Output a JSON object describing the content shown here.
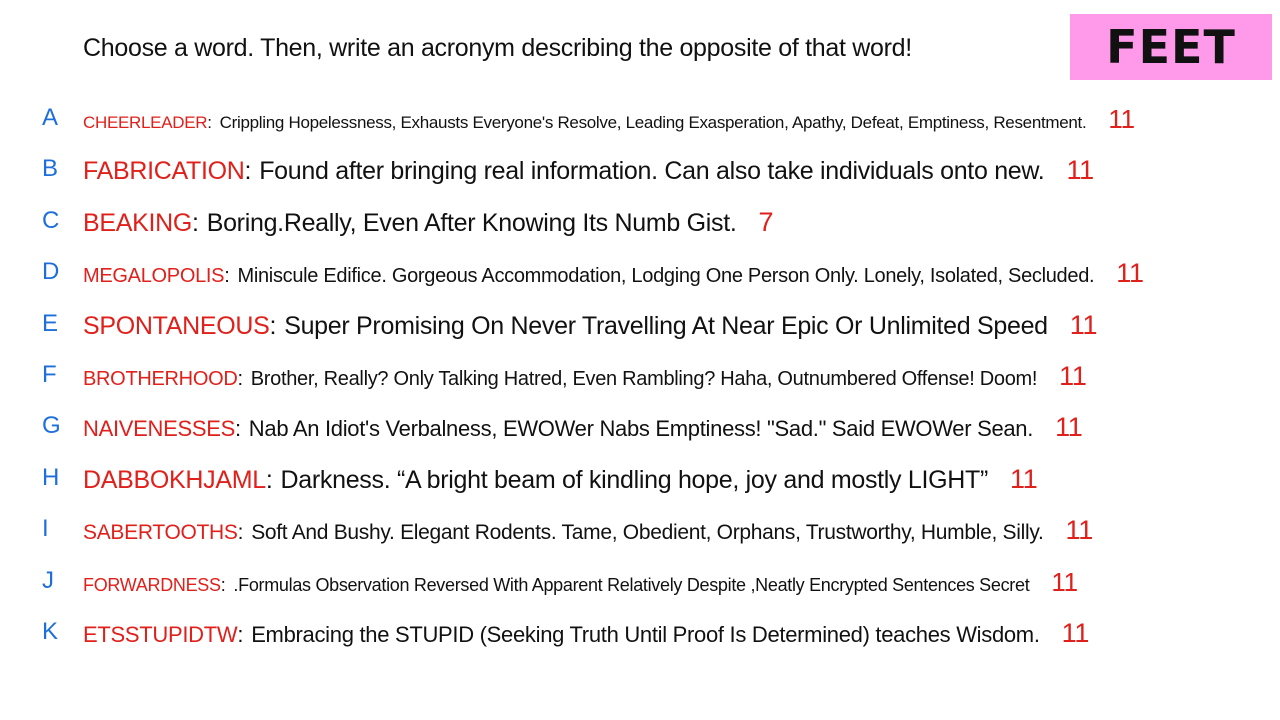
{
  "prompt": "Choose a word. Then, write an acronym describing the opposite of that word!",
  "badge": "FEET",
  "entries": [
    {
      "letter": "A",
      "word": "CHEERLEADER",
      "acronym": "Crippling Hopelessness, Exhausts Everyone's Resolve, Leading Exasperation, Apathy, Defeat, Emptiness, Resentment.",
      "score": "11"
    },
    {
      "letter": "B",
      "word": "FABRICATION",
      "acronym": "Found after bringing real information. Can also take individuals onto new.",
      "score": "11"
    },
    {
      "letter": "C",
      "word": "BEAKING",
      "acronym": "Boring.Really, Even After Knowing Its Numb Gist.",
      "score": "7"
    },
    {
      "letter": "D",
      "word": "MEGALOPOLIS",
      "acronym": "Miniscule Edifice. Gorgeous Accommodation, Lodging One Person Only. Lonely, Isolated, Secluded.",
      "score": "11"
    },
    {
      "letter": "E",
      "word": "SPONTANEOUS",
      "acronym": "Super Promising On Never Travelling At Near Epic Or Unlimited Speed",
      "score": "11"
    },
    {
      "letter": "F",
      "word": "BROTHERHOOD",
      "acronym": "Brother, Really? Only Talking Hatred, Even Rambling? Haha, Outnumbered Offense! Doom!",
      "score": "11"
    },
    {
      "letter": "G",
      "word": "NAIVENESSES",
      "acronym": "Nab An Idiot's Verbalness, EWOWer Nabs Emptiness! \"Sad.\" Said EWOWer Sean.",
      "score": "11"
    },
    {
      "letter": "H",
      "word": "DABBOKHJAML",
      "acronym": "Darkness. “A bright beam of kindling hope, joy and mostly LIGHT”",
      "score": "11"
    },
    {
      "letter": "I",
      "word": "SABERTOOTHS",
      "acronym": "Soft And Bushy. Elegant Rodents. Tame, Obedient, Orphans, Trustworthy, Humble, Silly.",
      "score": "11"
    },
    {
      "letter": "J",
      "word": "FORWARDNESS",
      "acronym": ".Formulas Observation Reversed With Apparent Relatively Despite ,Neatly Encrypted Sentences Secret",
      "score": "11"
    },
    {
      "letter": "K",
      "word": "ETSSTUPIDTW",
      "acronym": "Embracing the STUPID (Seeking Truth Until Proof Is Determined) teaches Wisdom.",
      "score": "11"
    }
  ],
  "colors": {
    "badge_bg": "#ff99ea",
    "word": "#e0201b",
    "letter": "#1e6fd9"
  }
}
